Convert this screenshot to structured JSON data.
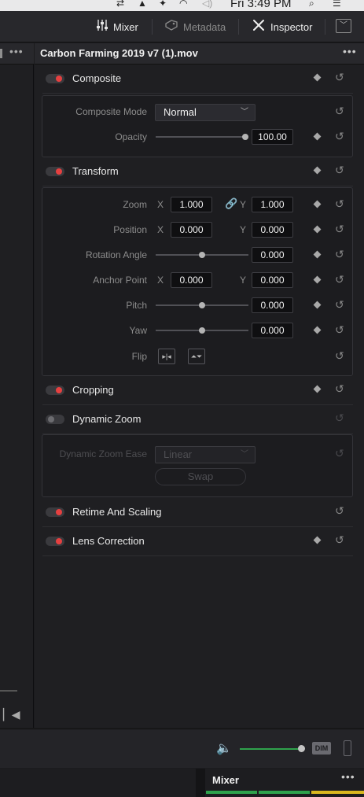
{
  "menubar": {
    "clock": "Fri 3:49 PM"
  },
  "toolbar": {
    "mixer_label": "Mixer",
    "metadata_label": "Metadata",
    "inspector_label": "Inspector"
  },
  "inspector": {
    "clip_title": "Carbon Farming 2019 v7 (1).mov",
    "composite": {
      "label": "Composite",
      "enabled": true,
      "mode_label": "Composite Mode",
      "mode_value": "Normal",
      "opacity_label": "Opacity",
      "opacity_value": "100.00",
      "opacity_fraction": 1.0
    },
    "transform": {
      "label": "Transform",
      "enabled": true,
      "zoom_label": "Zoom",
      "zoom_x": "1.000",
      "zoom_y": "1.000",
      "position_label": "Position",
      "position_x": "0.000",
      "position_y": "0.000",
      "rotation_label": "Rotation Angle",
      "rotation_value": "0.000",
      "anchor_label": "Anchor Point",
      "anchor_x": "0.000",
      "anchor_y": "0.000",
      "pitch_label": "Pitch",
      "pitch_value": "0.000",
      "yaw_label": "Yaw",
      "yaw_value": "0.000",
      "flip_label": "Flip",
      "x_axis": "X",
      "y_axis": "Y"
    },
    "cropping": {
      "label": "Cropping",
      "enabled": true
    },
    "dynamic_zoom": {
      "label": "Dynamic Zoom",
      "enabled": false,
      "ease_label": "Dynamic Zoom Ease",
      "ease_value": "Linear",
      "swap_label": "Swap"
    },
    "retime": {
      "label": "Retime And Scaling",
      "enabled": true
    },
    "lens": {
      "label": "Lens Correction",
      "enabled": true
    }
  },
  "audio": {
    "dim_label": "DIM"
  },
  "bottom": {
    "mixer_label": "Mixer"
  },
  "colors": {
    "accent_red": "#e64040",
    "meter_green": "#2fa24c",
    "meter_yellow": "#d9b71f"
  },
  "icons": {
    "mixer": "sliders-icon",
    "metadata": "tag-icon",
    "inspector": "wrench-icon",
    "reset": "reset-icon",
    "keyframe": "keyframe-diamond-icon",
    "link": "link-icon",
    "speaker": "speaker-icon"
  }
}
